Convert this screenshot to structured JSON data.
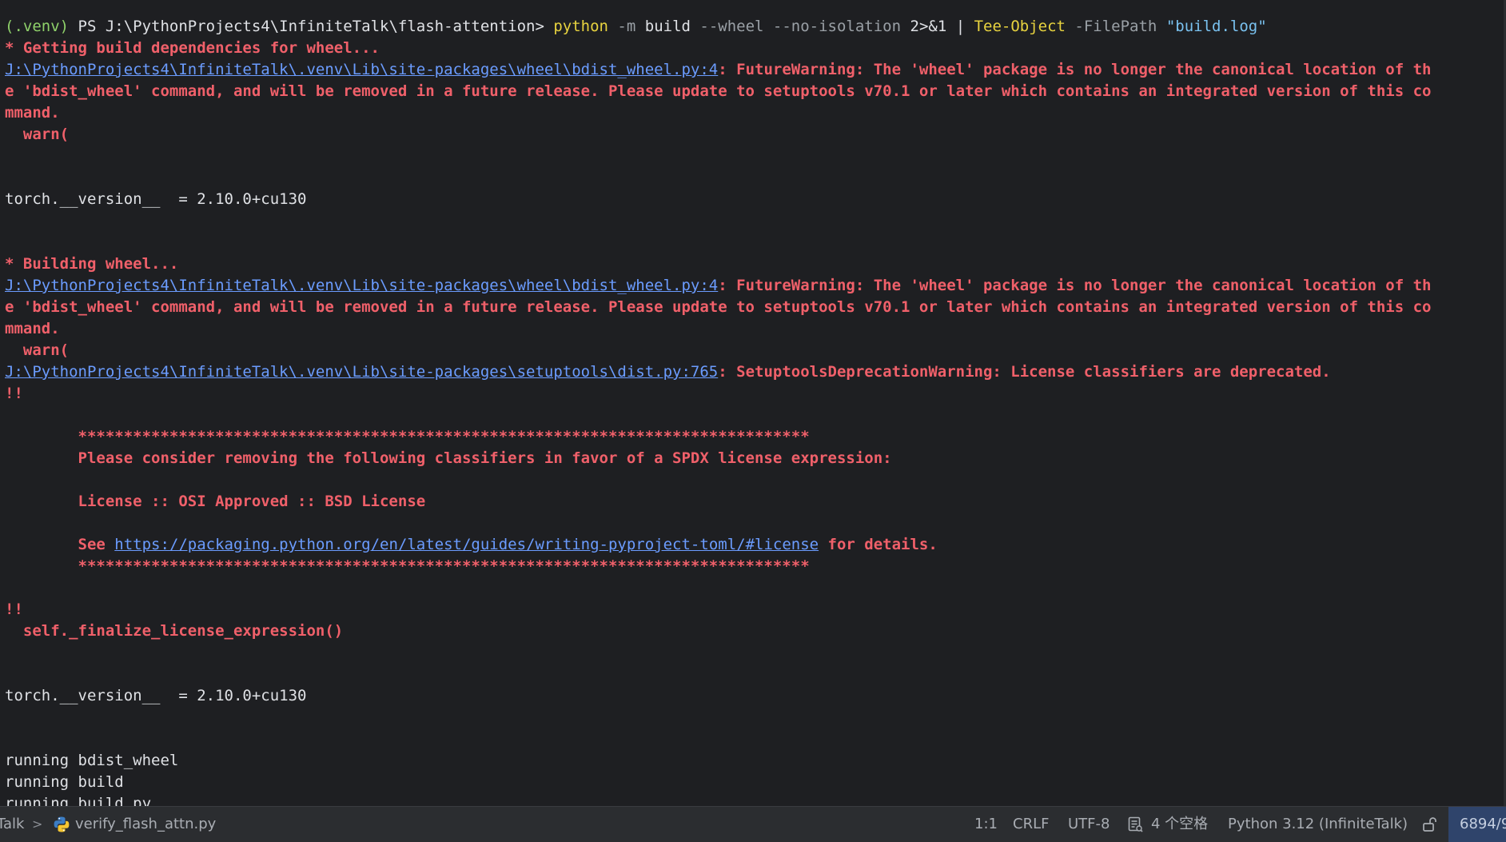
{
  "terminal": {
    "lines": [
      [
        {
          "t": "  ",
          "c": "dim"
        }
      ],
      [
        {
          "t": "(.venv) ",
          "c": "prompt"
        },
        {
          "t": "PS J:\\PythonProjects4\\InfiniteTalk\\flash-attention> ",
          "c": "default"
        },
        {
          "t": "python",
          "c": "cmd"
        },
        {
          "t": " -m ",
          "c": "flag"
        },
        {
          "t": "build",
          "c": "default"
        },
        {
          "t": " --wheel --no-isolation ",
          "c": "flag"
        },
        {
          "t": "2>&1 | ",
          "c": "default"
        },
        {
          "t": "Tee-Object",
          "c": "cmd"
        },
        {
          "t": " -FilePath ",
          "c": "flag"
        },
        {
          "t": "\"build.log\"",
          "c": "str"
        }
      ],
      [
        {
          "t": "* Getting build dependencies for wheel...",
          "c": "errb"
        }
      ],
      [
        {
          "t": "J:\\PythonProjects4\\InfiniteTalk\\.venv\\Lib\\site-packages\\wheel\\bdist_wheel.py:4",
          "c": "link"
        },
        {
          "t": ": FutureWarning: The 'wheel' package is no longer the canonical location of th",
          "c": "errb"
        }
      ],
      [
        {
          "t": "e 'bdist_wheel' command, and will be removed in a future release. Please update to setuptools v70.1 or later which contains an integrated version of this co",
          "c": "errb"
        }
      ],
      [
        {
          "t": "mmand.",
          "c": "errb"
        }
      ],
      [
        {
          "t": "  warn(",
          "c": "errb"
        }
      ],
      [
        {
          "t": "",
          "c": "default"
        }
      ],
      [
        {
          "t": "",
          "c": "default"
        }
      ],
      [
        {
          "t": "torch.__version__  = 2.10.0+cu130",
          "c": "default"
        }
      ],
      [
        {
          "t": "",
          "c": "default"
        }
      ],
      [
        {
          "t": "",
          "c": "default"
        }
      ],
      [
        {
          "t": "* Building wheel...",
          "c": "errb"
        }
      ],
      [
        {
          "t": "J:\\PythonProjects4\\InfiniteTalk\\.venv\\Lib\\site-packages\\wheel\\bdist_wheel.py:4",
          "c": "link"
        },
        {
          "t": ": FutureWarning: The 'wheel' package is no longer the canonical location of th",
          "c": "errb"
        }
      ],
      [
        {
          "t": "e 'bdist_wheel' command, and will be removed in a future release. Please update to setuptools v70.1 or later which contains an integrated version of this co",
          "c": "errb"
        }
      ],
      [
        {
          "t": "mmand.",
          "c": "errb"
        }
      ],
      [
        {
          "t": "  warn(",
          "c": "errb"
        }
      ],
      [
        {
          "t": "J:\\PythonProjects4\\InfiniteTalk\\.venv\\Lib\\site-packages\\setuptools\\dist.py:765",
          "c": "link"
        },
        {
          "t": ": SetuptoolsDeprecationWarning: License classifiers are deprecated.",
          "c": "errb"
        }
      ],
      [
        {
          "t": "!!",
          "c": "errb"
        }
      ],
      [
        {
          "t": "",
          "c": "default"
        }
      ],
      [
        {
          "t": "        ********************************************************************************",
          "c": "errb"
        }
      ],
      [
        {
          "t": "        Please consider removing the following classifiers in favor of a SPDX license expression:",
          "c": "errb"
        }
      ],
      [
        {
          "t": "",
          "c": "default"
        }
      ],
      [
        {
          "t": "        License :: OSI Approved :: BSD License",
          "c": "errb"
        }
      ],
      [
        {
          "t": "",
          "c": "default"
        }
      ],
      [
        {
          "t": "        See ",
          "c": "errb"
        },
        {
          "t": "https://packaging.python.org/en/latest/guides/writing-pyproject-toml/#license",
          "c": "link"
        },
        {
          "t": " for details.",
          "c": "errb"
        }
      ],
      [
        {
          "t": "        ********************************************************************************",
          "c": "errb"
        }
      ],
      [
        {
          "t": "",
          "c": "default"
        }
      ],
      [
        {
          "t": "!!",
          "c": "errb"
        }
      ],
      [
        {
          "t": "  self._finalize_license_expression()",
          "c": "errb"
        }
      ],
      [
        {
          "t": "",
          "c": "default"
        }
      ],
      [
        {
          "t": "",
          "c": "default"
        }
      ],
      [
        {
          "t": "torch.__version__  = 2.10.0+cu130",
          "c": "default"
        }
      ],
      [
        {
          "t": "",
          "c": "default"
        }
      ],
      [
        {
          "t": "",
          "c": "default"
        }
      ],
      [
        {
          "t": "running bdist_wheel",
          "c": "default"
        }
      ],
      [
        {
          "t": "running build",
          "c": "default"
        }
      ],
      [
        {
          "t": "running build_py",
          "c": "default"
        }
      ]
    ]
  },
  "statusbar": {
    "project_crumb": "Talk",
    "chevron": ">",
    "file": "verify_flash_attn.py",
    "file_icon": "python-icon",
    "position": "1:1",
    "line_ending": "CRLF",
    "encoding": "UTF-8",
    "indent_icon": "indent-icon",
    "indent": "4 个空格",
    "interpreter": "Python 3.12 (InfiniteTalk)",
    "lock_icon": "unlock-icon",
    "memory": "6894/9"
  }
}
